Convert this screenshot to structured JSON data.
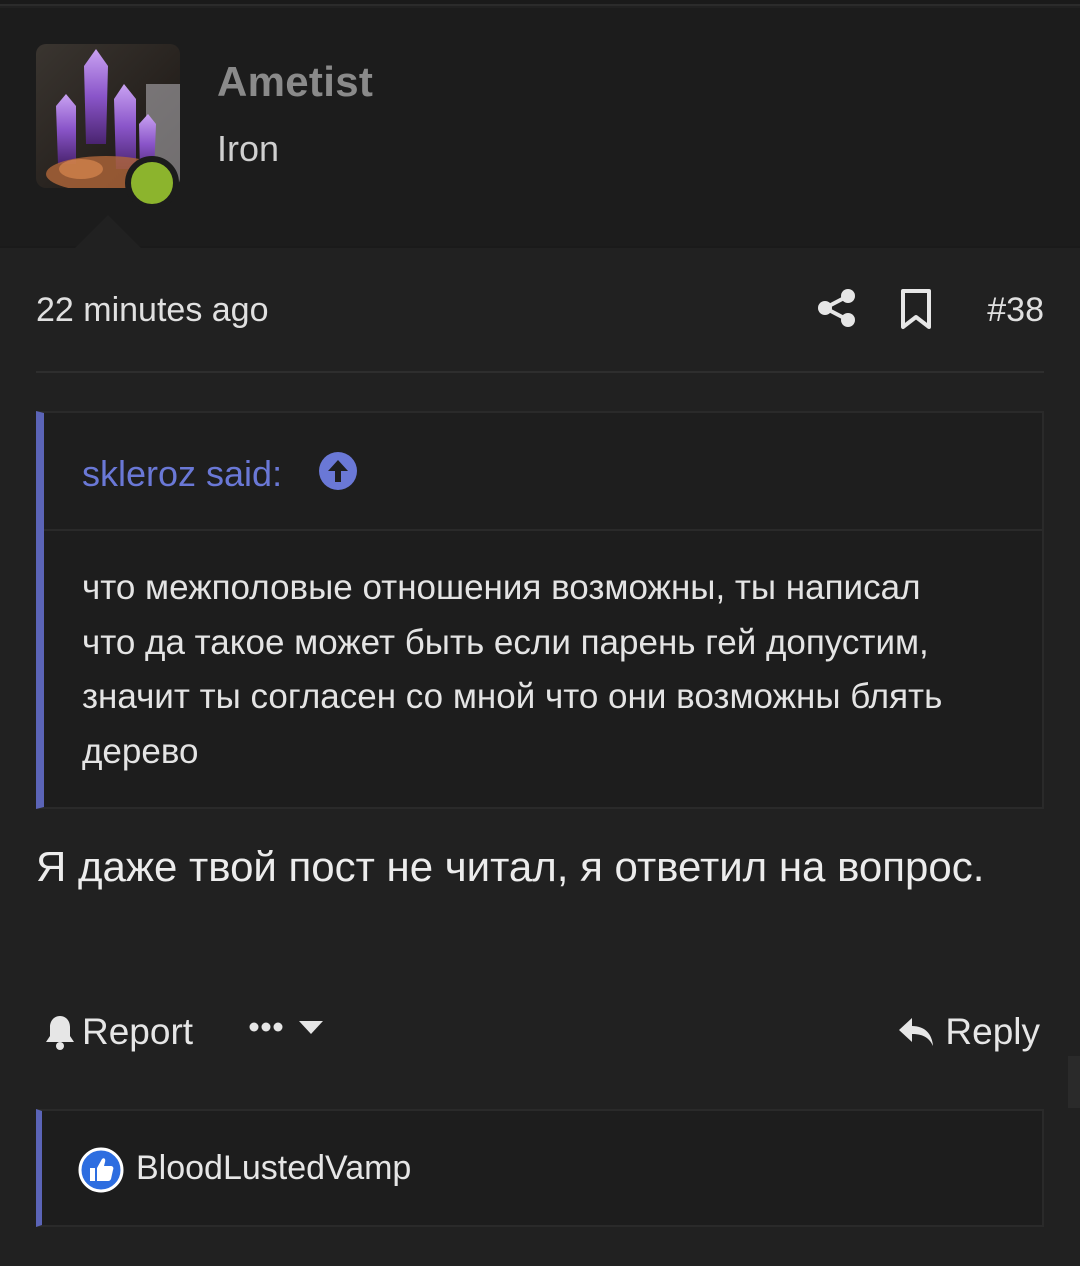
{
  "user": {
    "name": "Ametist",
    "title": "Iron",
    "online_color": "#8cb42d"
  },
  "post": {
    "time": "22 minutes ago",
    "number": "#38",
    "message": "Я даже твой пост не читал, я ответил на вопрос."
  },
  "quote": {
    "author": "skleroz said:",
    "body": "что межполовые отношения возможны, ты написал что да такое может быть если парень гей допустим, значит ты согласен со мной что они возможны блять дерево"
  },
  "actions": {
    "report_label": "Report",
    "reply_label": "Reply"
  },
  "reactions": {
    "user": "BloodLustedVamp"
  },
  "colors": {
    "accent": "#5b64b7",
    "quote_author": "#6a78d6",
    "background": "#212121"
  },
  "icons": {
    "share": "share-icon",
    "bookmark": "bookmark-icon",
    "quote_jump": "arrow-up-circle-icon",
    "report": "bell-icon",
    "more": "ellipsis-icon",
    "reply": "reply-arrow-icon",
    "like": "thumbs-up-icon"
  }
}
